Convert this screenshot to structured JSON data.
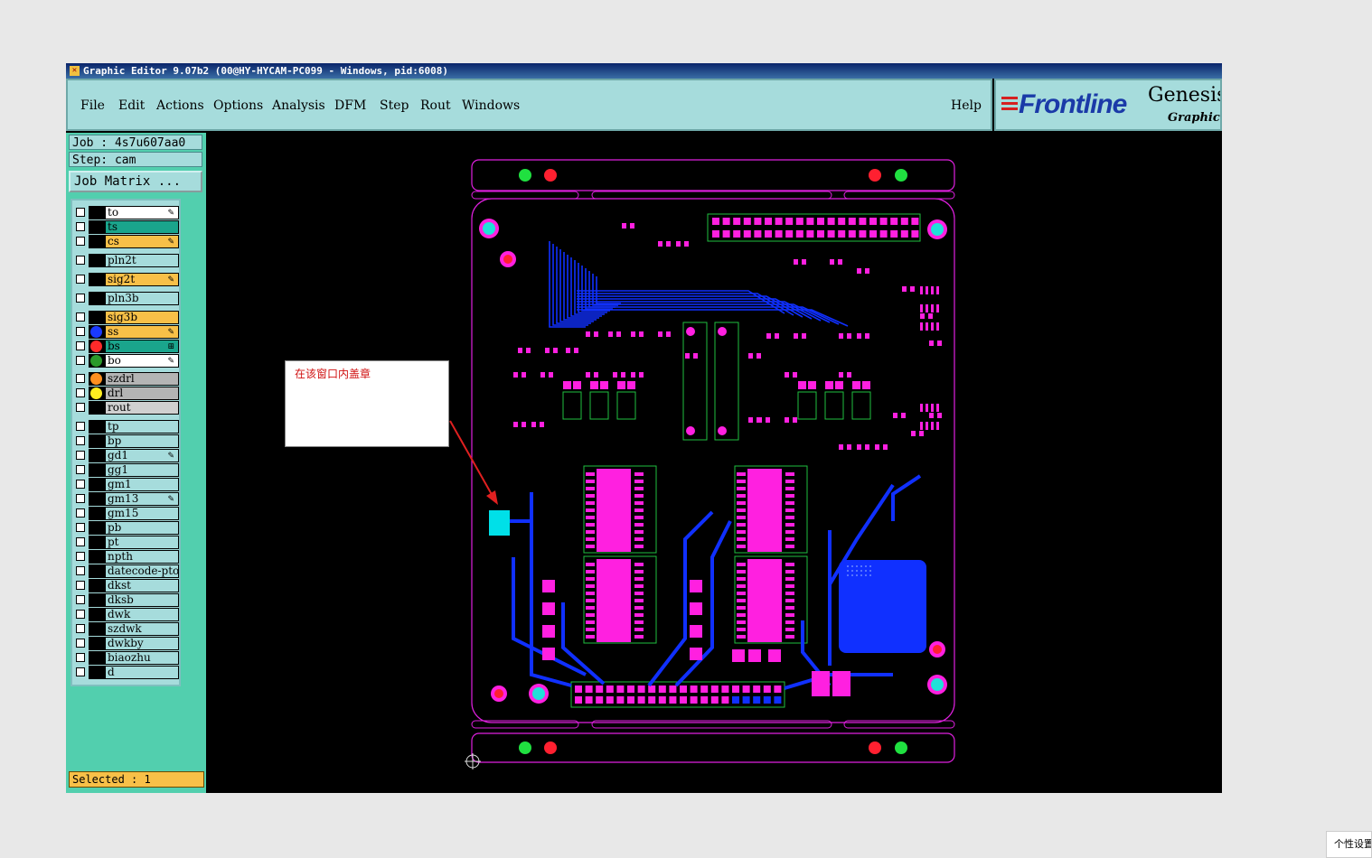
{
  "window": {
    "title": "Graphic Editor 9.07b2 (00@HY-HYCAM-PC099 - Windows, pid:6008)"
  },
  "menu": {
    "items": [
      "File",
      "Edit",
      "Actions",
      "Options",
      "Analysis",
      "DFM",
      "Step",
      "Rout",
      "Windows"
    ],
    "help": "Help"
  },
  "logo": {
    "brand": "Frontline",
    "product": "Genesis",
    "subtitle": "Graphic E"
  },
  "job": {
    "job_line": "Job : 4s7u607aa0",
    "step_line": "Step: cam",
    "matrix_button": "Job Matrix ..."
  },
  "layers": [
    {
      "name": "to",
      "color": "#ffffff",
      "marker": "✎",
      "dot": ""
    },
    {
      "name": "ts",
      "color": "#1aa58c",
      "marker": "",
      "dot": ""
    },
    {
      "name": "cs",
      "color": "#f8c048",
      "marker": "✎",
      "dot": ""
    },
    {
      "name": "pln2t",
      "color": "#a6dcdc",
      "marker": "",
      "dot": ""
    },
    {
      "name": "sig2t",
      "color": "#f8c048",
      "marker": "✎",
      "dot": ""
    },
    {
      "name": "pln3b",
      "color": "#a6dcdc",
      "marker": "",
      "dot": ""
    },
    {
      "name": "sig3b",
      "color": "#f8c048",
      "marker": "",
      "dot": ""
    },
    {
      "name": "ss",
      "color": "#f8c048",
      "marker": "✎",
      "dot": "#1a3aff"
    },
    {
      "name": "bs",
      "color": "#1aa58c",
      "marker": "⊞",
      "dot": "#ff2a2a"
    },
    {
      "name": "bo",
      "color": "#ffffff",
      "marker": "✎",
      "dot": "#2a9a2a"
    },
    {
      "name": "szdrl",
      "color": "#b4b4b4",
      "marker": "",
      "dot": "#ff9020"
    },
    {
      "name": "drl",
      "color": "#b4b4b4",
      "marker": "",
      "dot": "#ffee20"
    },
    {
      "name": "rout",
      "color": "#d0d0d0",
      "marker": "",
      "dot": ""
    },
    {
      "name": "tp",
      "color": "#a6dcdc",
      "marker": "",
      "dot": ""
    },
    {
      "name": "bp",
      "color": "#a6dcdc",
      "marker": "",
      "dot": ""
    },
    {
      "name": "gd1",
      "color": "#a6dcdc",
      "marker": "✎",
      "dot": ""
    },
    {
      "name": "gg1",
      "color": "#a6dcdc",
      "marker": "",
      "dot": ""
    },
    {
      "name": "gm1",
      "color": "#a6dcdc",
      "marker": "",
      "dot": ""
    },
    {
      "name": "gm13",
      "color": "#a6dcdc",
      "marker": "✎",
      "dot": ""
    },
    {
      "name": "gm15",
      "color": "#a6dcdc",
      "marker": "",
      "dot": ""
    },
    {
      "name": "pb",
      "color": "#a6dcdc",
      "marker": "",
      "dot": ""
    },
    {
      "name": "pt",
      "color": "#a6dcdc",
      "marker": "",
      "dot": ""
    },
    {
      "name": "npth",
      "color": "#a6dcdc",
      "marker": "",
      "dot": ""
    },
    {
      "name": "datecode-pto",
      "color": "#a6dcdc",
      "marker": "",
      "dot": ""
    },
    {
      "name": "dkst",
      "color": "#a6dcdc",
      "marker": "",
      "dot": ""
    },
    {
      "name": "dksb",
      "color": "#a6dcdc",
      "marker": "",
      "dot": ""
    },
    {
      "name": "dwk",
      "color": "#a6dcdc",
      "marker": "",
      "dot": ""
    },
    {
      "name": "szdwk",
      "color": "#a6dcdc",
      "marker": "",
      "dot": ""
    },
    {
      "name": "dwkby",
      "color": "#a6dcdc",
      "marker": "",
      "dot": ""
    },
    {
      "name": "biaozhu",
      "color": "#a6dcdc",
      "marker": "",
      "dot": ""
    },
    {
      "name": "d",
      "color": "#a6dcdc",
      "marker": "",
      "dot": ""
    }
  ],
  "status": {
    "selected": "Selected : 1"
  },
  "annotation": {
    "text": "在该窗口内盖章"
  },
  "taskbar_corner": {
    "text": "个性设置"
  },
  "colors": {
    "board_outline": "#e020e0",
    "pad": "#ff20e0",
    "trace": "#1030ff",
    "hole_red": "#ff2030",
    "hole_green": "#20e040",
    "fiducial": "#20e0d8",
    "selection": "#00e0e8",
    "arrow": "#e02020"
  }
}
